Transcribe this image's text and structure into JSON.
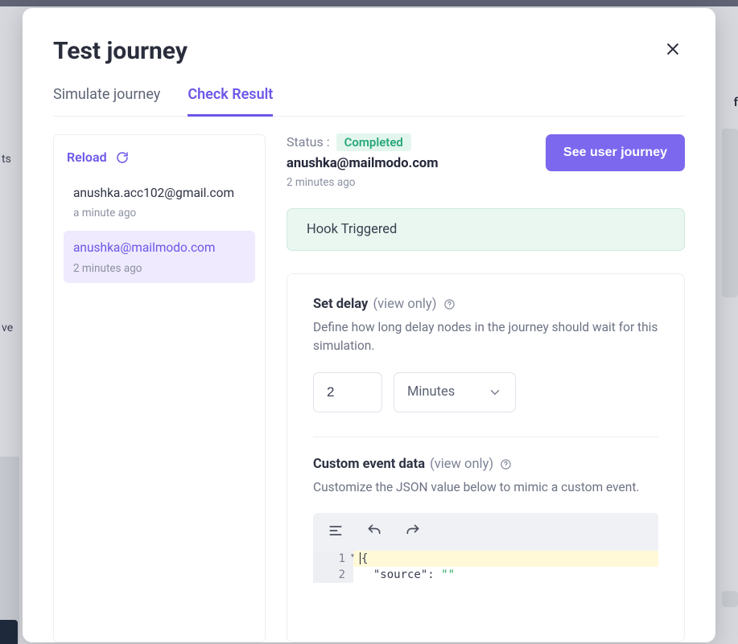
{
  "modal": {
    "title": "Test journey",
    "tabs": [
      {
        "label": "Simulate journey",
        "active": false
      },
      {
        "label": "Check Result",
        "active": true
      }
    ]
  },
  "sidebar": {
    "reload_label": "Reload",
    "items": [
      {
        "email": "anushka.acc102@gmail.com",
        "time": "a minute ago",
        "selected": false
      },
      {
        "email": "anushka@mailmodo.com",
        "time": "2 minutes ago",
        "selected": true
      }
    ]
  },
  "status": {
    "label": "Status :",
    "value": "Completed",
    "email": "anushka@mailmodo.com",
    "time": "2 minutes ago",
    "button_label": "See user journey"
  },
  "hook": {
    "text": "Hook Triggered"
  },
  "delay": {
    "title": "Set delay",
    "viewonly": "(view only)",
    "desc": "Define how long delay nodes in the journey should wait for this simulation.",
    "value": "2",
    "unit": "Minutes"
  },
  "custom_event": {
    "title": "Custom event data",
    "viewonly": "(view only)",
    "desc": "Customize the JSON value below to mimic a custom event."
  },
  "editor": {
    "line_numbers": [
      "1",
      "2"
    ],
    "lines": {
      "l1": "{",
      "l2_key": "\"source\"",
      "l2_value": "\"\""
    }
  },
  "bg": {
    "ts": "ts",
    "ve": "ve",
    "f": "f"
  }
}
